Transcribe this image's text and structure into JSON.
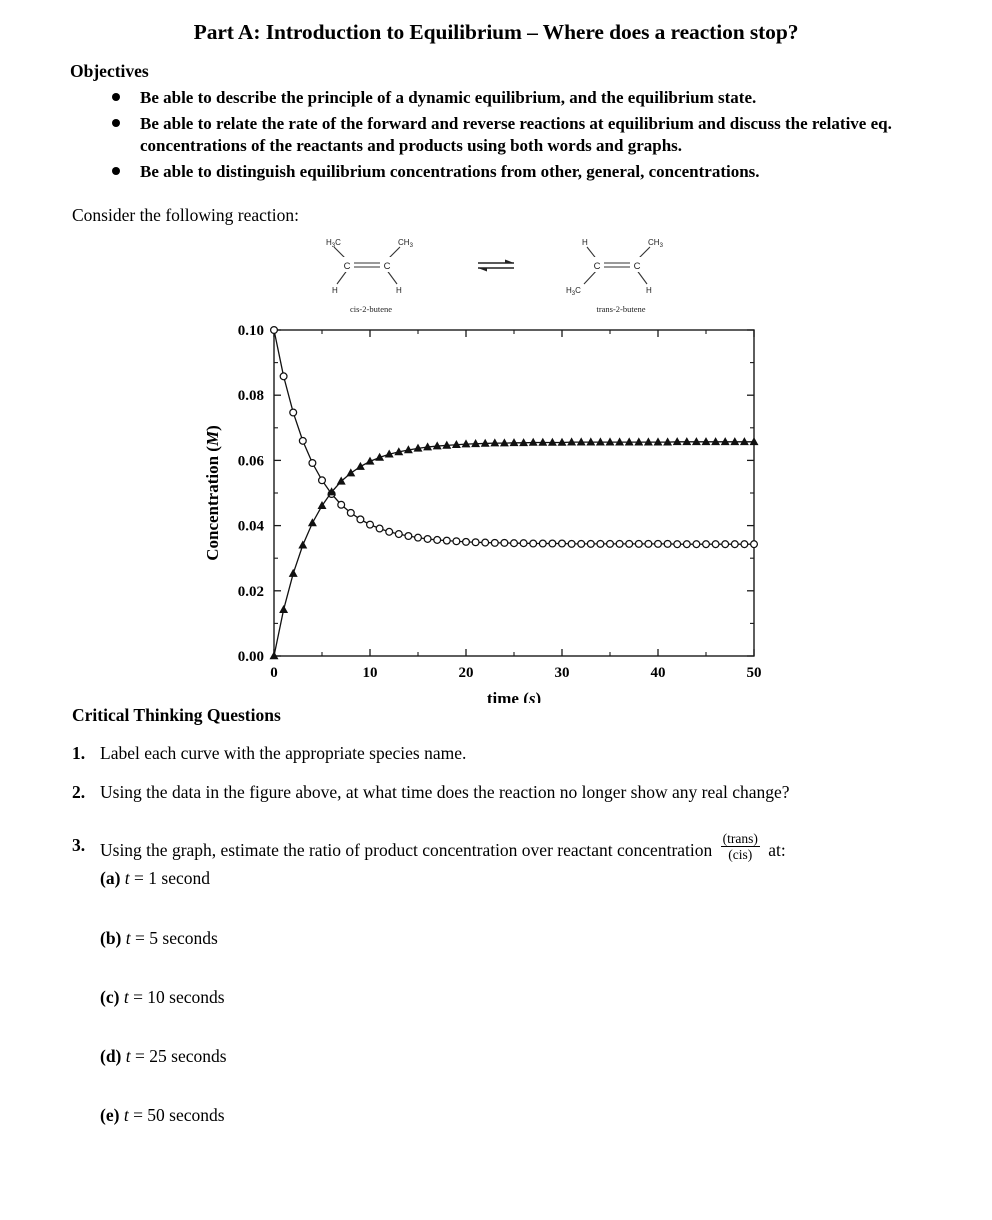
{
  "title": "Part A: Introduction to Equilibrium – Where does a reaction stop?",
  "objectives_heading": "Objectives",
  "objectives": [
    "Be able to describe the principle of a dynamic equilibrium, and the equilibrium state.",
    "Be able to relate the rate of the forward and reverse reactions at equilibrium and discuss the relative eq. concentrations of the reactants and products using both words and graphs.",
    "Be able to distinguish equilibrium concentrations from other, general, concentrations."
  ],
  "consider_line": "Consider the following reaction:",
  "reaction": {
    "left": {
      "name": "cis-2-butene",
      "top_left_label": "H3C",
      "top_right_label": "CH3",
      "bottom_left_label": "H",
      "bottom_right_label": "H",
      "carbon_label": "C"
    },
    "right": {
      "name": "trans-2-butene",
      "top_left_label": "H",
      "top_right_label": "CH3",
      "bottom_left_label": "H3C",
      "bottom_right_label": "H",
      "carbon_label": "C"
    },
    "arrow": "equilibrium-double-harpoon"
  },
  "chart_data": {
    "type": "line",
    "title": "",
    "xlabel": "time (s)",
    "ylabel": "Concentration (M)",
    "xlim": [
      0,
      50
    ],
    "ylim": [
      0.0,
      0.1
    ],
    "xticks": [
      0,
      10,
      20,
      30,
      40,
      50
    ],
    "xtick_labels": [
      "0",
      "10",
      "20",
      "30",
      "40",
      "50"
    ],
    "xminor_step": 5,
    "yticks": [
      0.0,
      0.02,
      0.04,
      0.06,
      0.08,
      0.1
    ],
    "ytick_labels": [
      "0.00",
      "0.02",
      "0.04",
      "0.06",
      "0.08",
      "0.10"
    ],
    "yminor_step": 0.01,
    "grid": false,
    "legend": "none",
    "frame": "box-all-sides-ticks-inward",
    "x": [
      0,
      1,
      2,
      3,
      4,
      5,
      6,
      7,
      8,
      9,
      10,
      11,
      12,
      13,
      14,
      15,
      16,
      17,
      18,
      19,
      20,
      21,
      22,
      23,
      24,
      25,
      26,
      27,
      28,
      29,
      30,
      31,
      32,
      33,
      34,
      35,
      36,
      37,
      38,
      39,
      40,
      41,
      42,
      43,
      44,
      45,
      46,
      47,
      48,
      49,
      50
    ],
    "series": [
      {
        "name": "cis-2-butene",
        "marker": "open-circle",
        "equilibrium_value": 0.0335,
        "initial_value": 0.1,
        "values": [
          0.1,
          0.0858,
          0.0747,
          0.066,
          0.0592,
          0.0539,
          0.0497,
          0.0464,
          0.0439,
          0.0419,
          0.0403,
          0.0391,
          0.0381,
          0.0374,
          0.0368,
          0.0363,
          0.0359,
          0.0356,
          0.0354,
          0.0352,
          0.035,
          0.0349,
          0.0348,
          0.0347,
          0.0347,
          0.0346,
          0.0346,
          0.0345,
          0.0345,
          0.0345,
          0.0345,
          0.0344,
          0.0344,
          0.0344,
          0.0344,
          0.0344,
          0.0344,
          0.0344,
          0.0344,
          0.0344,
          0.0344,
          0.0344,
          0.0343,
          0.0343,
          0.0343,
          0.0343,
          0.0343,
          0.0343,
          0.0343,
          0.0343,
          0.0343
        ]
      },
      {
        "name": "trans-2-butene",
        "marker": "filled-triangle",
        "equilibrium_value": 0.0665,
        "initial_value": 0.0,
        "values": [
          0.0,
          0.0142,
          0.0253,
          0.034,
          0.0408,
          0.0461,
          0.0503,
          0.0536,
          0.0561,
          0.0581,
          0.0597,
          0.0609,
          0.0619,
          0.0626,
          0.0632,
          0.0637,
          0.0641,
          0.0644,
          0.0646,
          0.0648,
          0.065,
          0.0651,
          0.0652,
          0.0653,
          0.0653,
          0.0654,
          0.0654,
          0.0655,
          0.0655,
          0.0655,
          0.0655,
          0.0656,
          0.0656,
          0.0656,
          0.0656,
          0.0656,
          0.0656,
          0.0656,
          0.0656,
          0.0656,
          0.0656,
          0.0656,
          0.0657,
          0.0657,
          0.0657,
          0.0657,
          0.0657,
          0.0657,
          0.0657,
          0.0657,
          0.0657
        ]
      }
    ]
  },
  "questions_heading": "Critical Thinking Questions",
  "questions": [
    {
      "num": "1.",
      "text": "Label each curve with the appropriate species name."
    },
    {
      "num": "2.",
      "text": "Using the data in the figure above, at what time does the reaction no longer show any real change?"
    }
  ],
  "question3": {
    "num": "3.",
    "text_before": "Using the graph, estimate the ratio of product concentration over reactant concentration",
    "fraction_numerator": "(trans)",
    "fraction_denominator": "(cis)",
    "text_after": "at:",
    "subitems": [
      {
        "label": "(a)",
        "var": "t",
        "eq": "= 1 second"
      },
      {
        "label": "(b)",
        "var": "t",
        "eq": "= 5 seconds"
      },
      {
        "label": "(c)",
        "var": "t",
        "eq": "= 10 seconds"
      },
      {
        "label": "(d)",
        "var": "t",
        "eq": "= 25 seconds"
      },
      {
        "label": "(e)",
        "var": "t",
        "eq": "= 50 seconds"
      }
    ]
  },
  "colors": {
    "ink": "#000000",
    "line": "#1a1a1a"
  }
}
